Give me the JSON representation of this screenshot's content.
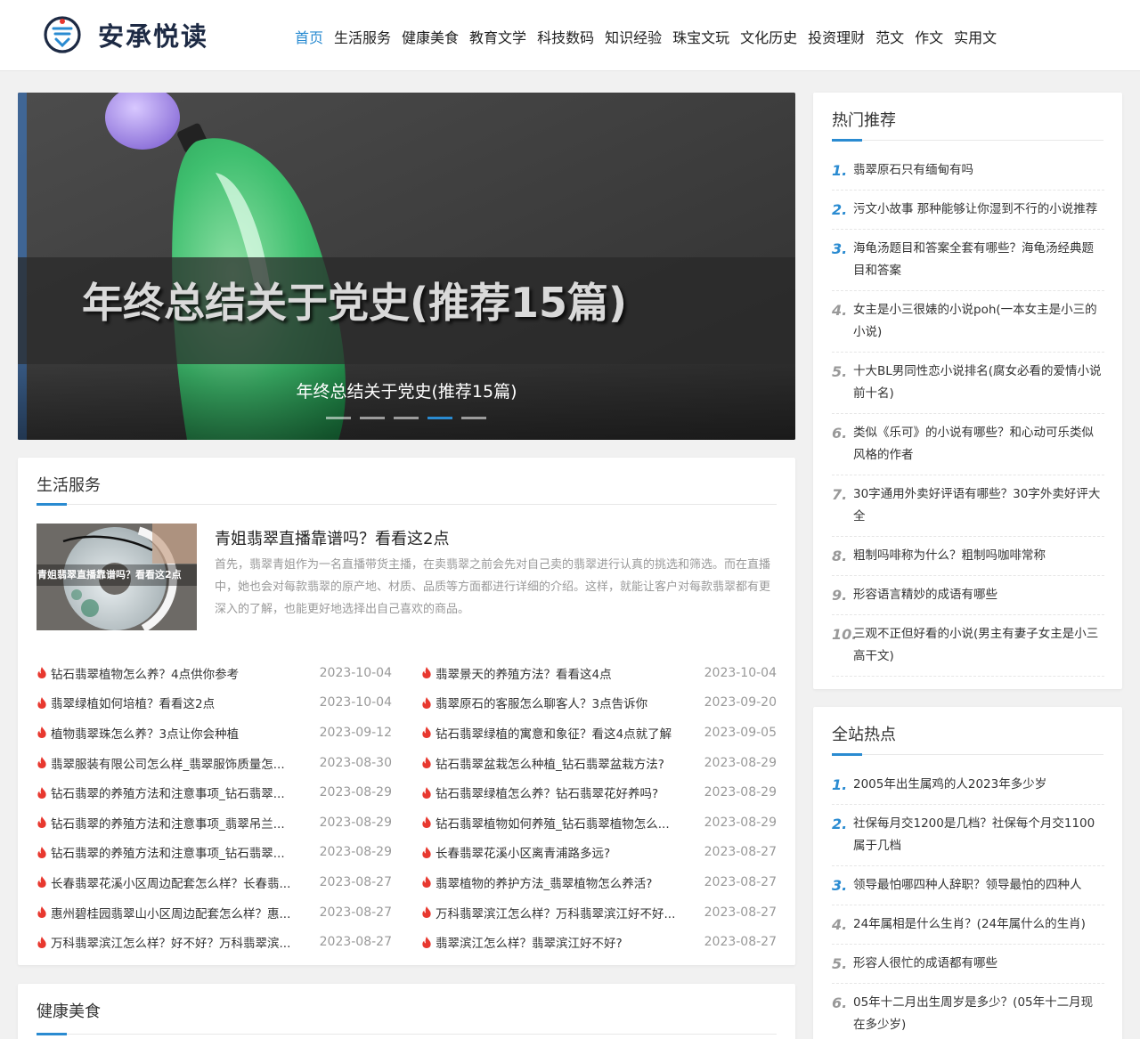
{
  "site": {
    "name": "安承悦读"
  },
  "nav": {
    "items": [
      {
        "label": "首页",
        "active": true
      },
      {
        "label": "生活服务"
      },
      {
        "label": "健康美食"
      },
      {
        "label": "教育文学"
      },
      {
        "label": "科技数码"
      },
      {
        "label": "知识经验"
      },
      {
        "label": "珠宝文玩"
      },
      {
        "label": "文化历史"
      },
      {
        "label": "投资理财"
      },
      {
        "label": "范文"
      },
      {
        "label": "作文"
      },
      {
        "label": "实用文"
      }
    ]
  },
  "slider": {
    "image_text": "年终总结关于党史(推荐15篇)",
    "caption": "年终总结关于党史(推荐15篇)",
    "dot_count": 5,
    "active_dot": 4
  },
  "life_section": {
    "title": "生活服务",
    "featured": {
      "image_label": "青姐翡翠直播靠谱吗？看看这2点",
      "title": "青姐翡翠直播靠谱吗？看看这2点",
      "description": "首先，翡翠青姐作为一名直播带货主播，在卖翡翠之前会先对自己卖的翡翠进行认真的挑选和筛选。而在直播中，她也会对每款翡翠的原产地、材质、品质等方面都进行详细的介绍。这样，就能让客户对每款翡翠都有更深入的了解，也能更好地选择出自己喜欢的商品。"
    },
    "left_list": [
      {
        "title": "钻石翡翠植物怎么养？4点供你参考",
        "date": "2023-10-04"
      },
      {
        "title": "翡翠绿植如何培植？看看这2点",
        "date": "2023-10-04"
      },
      {
        "title": "植物翡翠珠怎么养？3点让你会种植",
        "date": "2023-09-12"
      },
      {
        "title": "翡翠服装有限公司怎么样_翡翠服饰质量怎...",
        "date": "2023-08-30"
      },
      {
        "title": "钻石翡翠的养殖方法和注意事项_钻石翡翠...",
        "date": "2023-08-29"
      },
      {
        "title": "钻石翡翠的养殖方法和注意事项_翡翠吊兰...",
        "date": "2023-08-29"
      },
      {
        "title": "钻石翡翠的养殖方法和注意事项_钻石翡翠...",
        "date": "2023-08-29"
      },
      {
        "title": "长春翡翠花溪小区周边配套怎么样？长春翡...",
        "date": "2023-08-27"
      },
      {
        "title": "惠州碧桂园翡翠山小区周边配套怎么样？惠...",
        "date": "2023-08-27"
      },
      {
        "title": "万科翡翠滨江怎么样？好不好？万科翡翠滨...",
        "date": "2023-08-27"
      }
    ],
    "right_list": [
      {
        "title": "翡翠景天的养殖方法？看看这4点",
        "date": "2023-10-04"
      },
      {
        "title": "翡翠原石的客服怎么聊客人？3点告诉你",
        "date": "2023-09-20"
      },
      {
        "title": "钻石翡翠绿植的寓意和象征？看这4点就了解",
        "date": "2023-09-05"
      },
      {
        "title": "钻石翡翠盆栽怎么种植_钻石翡翠盆栽方法?",
        "date": "2023-08-29"
      },
      {
        "title": "钻石翡翠绿植怎么养？钻石翡翠花好养吗?",
        "date": "2023-08-29"
      },
      {
        "title": "钻石翡翠植物如何养殖_钻石翡翠植物怎么...",
        "date": "2023-08-29"
      },
      {
        "title": "长春翡翠花溪小区离青浦路多远?",
        "date": "2023-08-27"
      },
      {
        "title": "翡翠植物的养护方法_翡翠植物怎么养活?",
        "date": "2023-08-27"
      },
      {
        "title": "万科翡翠滨江怎么样？万科翡翠滨江好不好...",
        "date": "2023-08-27"
      },
      {
        "title": "翡翠滨江怎么样？翡翠滨江好不好?",
        "date": "2023-08-27"
      }
    ]
  },
  "health_section": {
    "title": "健康美食"
  },
  "hot_recommend": {
    "title": "热门推荐",
    "items": [
      {
        "num": "1.",
        "title": "翡翠原石只有缅甸有吗"
      },
      {
        "num": "2.",
        "title": "污文小故事 那种能够让你湿到不行的小说推荐"
      },
      {
        "num": "3.",
        "title": "海龟汤题目和答案全套有哪些？海龟汤经典题目和答案"
      },
      {
        "num": "4.",
        "title": "女主是小三很婊的小说poh(一本女主是小三的小说)"
      },
      {
        "num": "5.",
        "title": "十大BL男同性恋小说排名(腐女必看的爱情小说前十名)"
      },
      {
        "num": "6.",
        "title": "类似《乐可》的小说有哪些？和心动可乐类似风格的作者"
      },
      {
        "num": "7.",
        "title": "30字通用外卖好评语有哪些？30字外卖好评大全"
      },
      {
        "num": "8.",
        "title": "粗制吗啡称为什么？粗制吗咖啡常称"
      },
      {
        "num": "9.",
        "title": "形容语言精妙的成语有哪些"
      },
      {
        "num": "10.",
        "title": "三观不正但好看的小说(男主有妻子女主是小三高干文)"
      }
    ]
  },
  "site_hot": {
    "title": "全站热点",
    "items": [
      {
        "num": "1.",
        "title": "2005年出生属鸡的人2023年多少岁"
      },
      {
        "num": "2.",
        "title": "社保每月交1200是几档？社保每个月交1100属于几档"
      },
      {
        "num": "3.",
        "title": "领导最怕哪四种人辞职？领导最怕的四种人"
      },
      {
        "num": "4.",
        "title": "24年属相是什么生肖？(24年属什么的生肖)"
      },
      {
        "num": "5.",
        "title": "形容人很忙的成语都有哪些"
      },
      {
        "num": "6.",
        "title": "05年十二月出生周岁是多少？(05年十二月现在多少岁)"
      }
    ]
  },
  "colors": {
    "accent": "#2a8bd1",
    "hot": "#e8382f"
  }
}
